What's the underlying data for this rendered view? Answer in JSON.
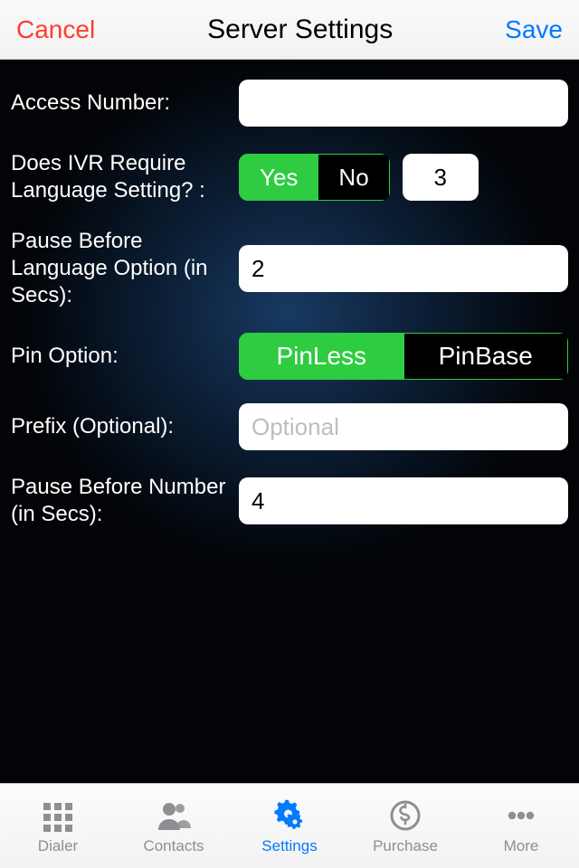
{
  "nav": {
    "cancel": "Cancel",
    "title": "Server Settings",
    "save": "Save"
  },
  "rows": {
    "access": {
      "label": "Access Number:",
      "value": ""
    },
    "ivr": {
      "label": "Does IVR Require Language Setting? :",
      "yes": "Yes",
      "no": "No",
      "num": "3"
    },
    "pauseLang": {
      "label": "Pause Before Language Option (in Secs):",
      "value": "2"
    },
    "pin": {
      "label": "Pin Option:",
      "a": "PinLess",
      "b": "PinBase"
    },
    "prefix": {
      "label": "Prefix (Optional):",
      "placeholder": "Optional",
      "value": ""
    },
    "pauseNum": {
      "label": "Pause Before Number (in Secs):",
      "value": "4"
    }
  },
  "tabs": {
    "dialer": "Dialer",
    "contacts": "Contacts",
    "settings": "Settings",
    "purchase": "Purchase",
    "more": "More"
  }
}
